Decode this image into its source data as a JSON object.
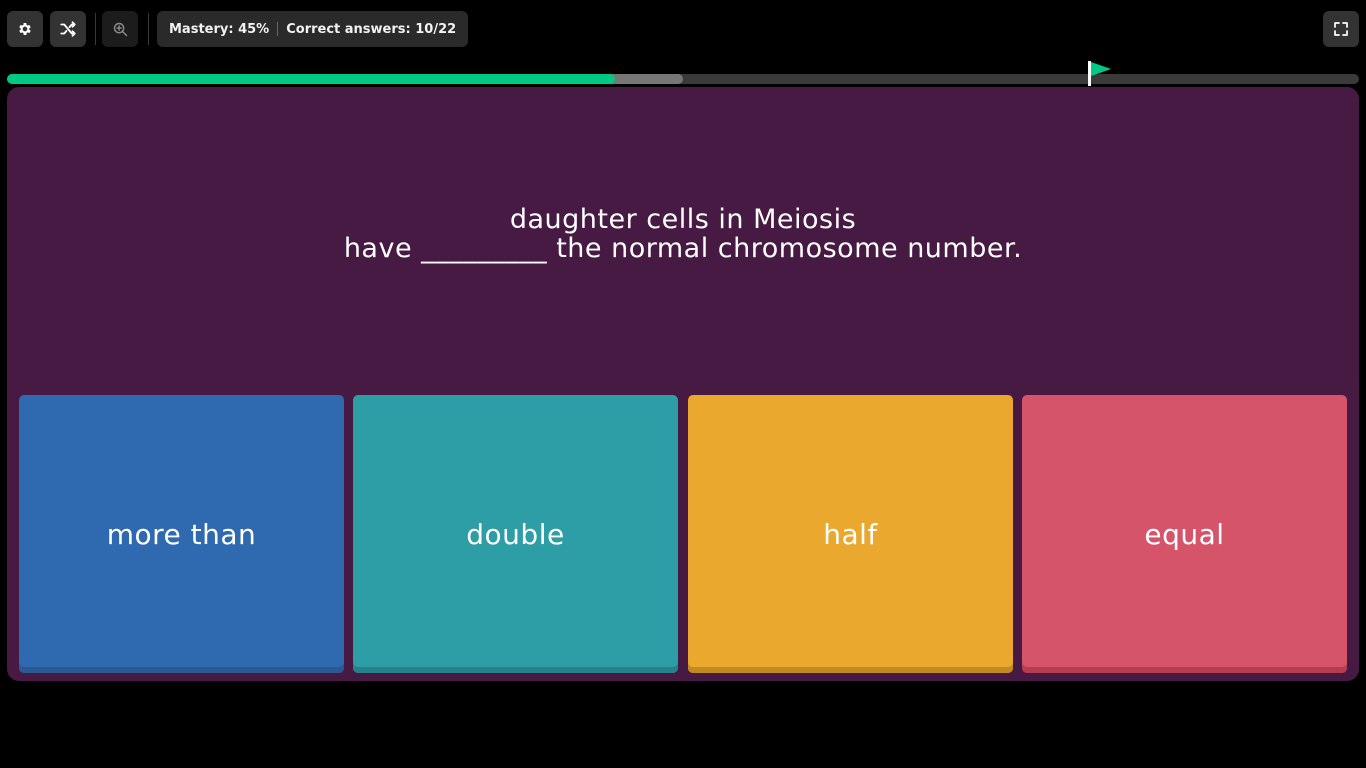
{
  "toolbar": {
    "settings_icon": "gear-icon",
    "shuffle_icon": "shuffle-icon",
    "zoom_icon": "zoom-in-icon",
    "fullscreen_icon": "fullscreen-icon"
  },
  "stats": {
    "mastery": "Mastery: 45%",
    "correct": "Correct answers: 10/22"
  },
  "progress": {
    "completed_fraction": 0.45,
    "buffer_fraction": 0.5,
    "goal_fraction": 0.8,
    "colors": {
      "fill": "#00c985",
      "buffer": "#777777",
      "track": "#3a3a3a",
      "flag": "#00c985"
    }
  },
  "question": {
    "line1": "daughter cells in Meiosis",
    "line2": "have _________ the normal chromosome number."
  },
  "panel_color": "#461a42",
  "options": [
    {
      "label": "more than",
      "color": "#2f6ab0",
      "shadow": "#2a5994"
    },
    {
      "label": "double",
      "color": "#2d9da6",
      "shadow": "#26818a"
    },
    {
      "label": "half",
      "color": "#eaa82f",
      "shadow": "#c48a22"
    },
    {
      "label": "equal",
      "color": "#d5546a",
      "shadow": "#b63c50"
    }
  ]
}
